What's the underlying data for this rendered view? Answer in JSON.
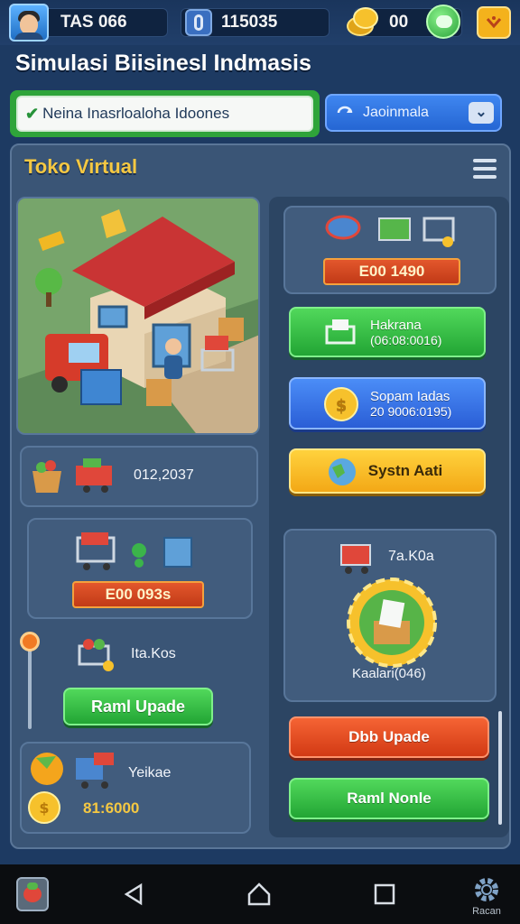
{
  "header": {
    "player_name": "TAS 066",
    "coins_label": "115035",
    "gold_label": "00"
  },
  "title": "Simulasi Biisinesl Indmasis",
  "search": {
    "value": "Neina Inasrloaloha Idoones"
  },
  "region_select": {
    "value": "Jaoinmala"
  },
  "panel": {
    "title": "Toko Virtual"
  },
  "store_preview": {
    "price": "E00 1490"
  },
  "buttons": {
    "btn1": {
      "line1": "Hakrana",
      "line2": "(06:08:0016)"
    },
    "btn2": {
      "line1": "Sopam Iadas",
      "line2": "20 9006:0195)"
    },
    "btn3": {
      "label": "Systn Aati"
    },
    "red_btn": {
      "label": "Dbb Upade"
    },
    "green_btn": {
      "label": "Raml Nonle"
    }
  },
  "items": {
    "produce_price": "012,2037",
    "cart_price_tag": "E00 093s",
    "cart_name": "Ita.Kos",
    "cart_button": "Raml Upade",
    "delivery_name": "Yeikae",
    "delivery_price": "81:6000",
    "shop_name": "7a.K0a",
    "shop_status": "Kaalari(046)"
  },
  "navbar": {
    "setting_label": "Racan"
  },
  "colors": {
    "background": "#1d3a62",
    "panel": "#3a5576",
    "accent_gold": "#f5c842",
    "green": "#2fa43a",
    "blue": "#2a64d6",
    "red": "#d23a14"
  }
}
